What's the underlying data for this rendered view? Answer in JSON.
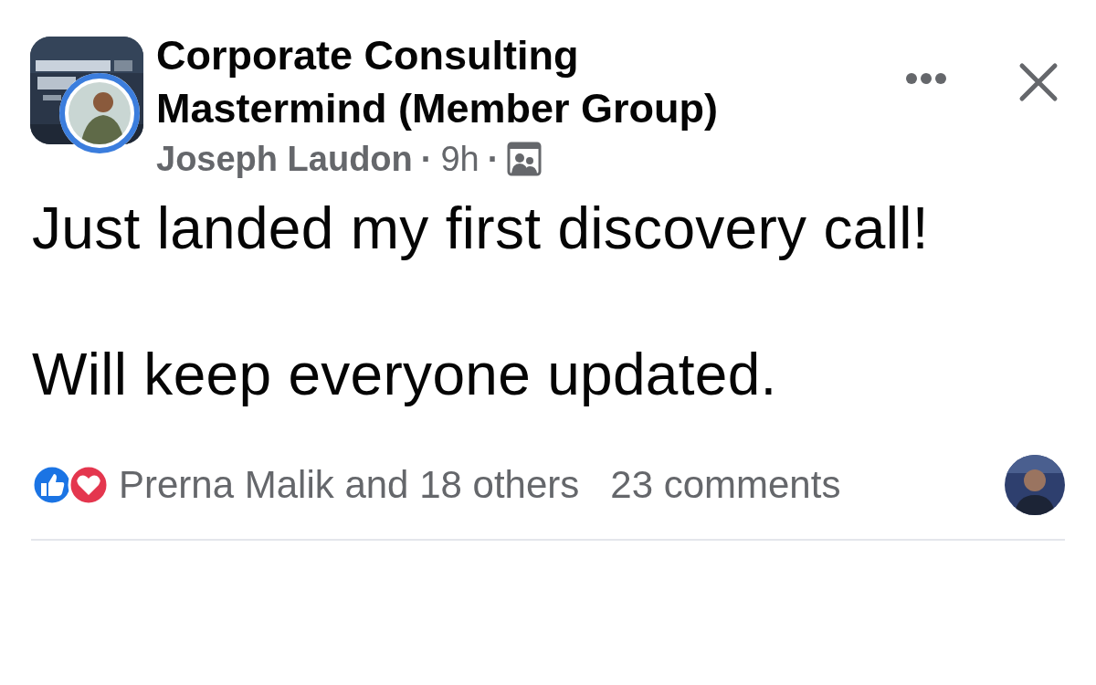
{
  "group_name": "Corporate Consulting Mastermind (Member Group)",
  "author": "Joseph Laudon",
  "separator": "·",
  "time": "9h",
  "post_paragraphs": [
    "Just landed my first discovery call!",
    "Will keep everyone updated."
  ],
  "reactions_text": "Prerna Malik and 18 others",
  "comments_text": "23 comments"
}
